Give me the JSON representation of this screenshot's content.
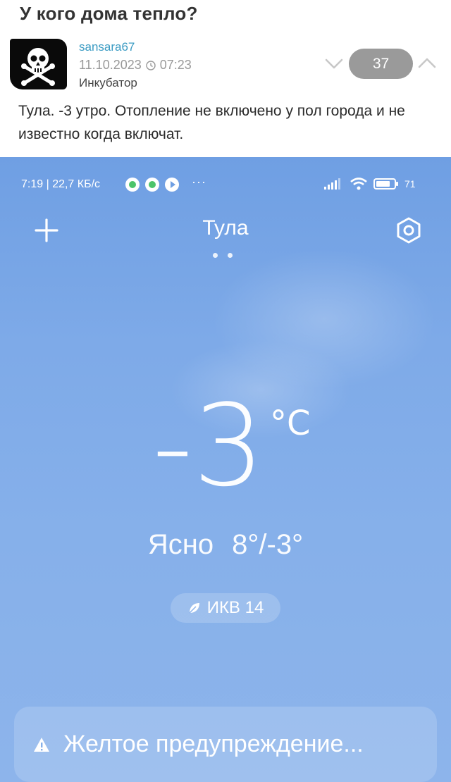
{
  "post": {
    "title": "У кого дома тепло?",
    "author": "sansara67",
    "date": "11.10.2023",
    "time": "07:23",
    "community": "Инкубатор",
    "rating": "37",
    "text": "Тула. -3 утро. Отопление не включено у пол города и не известно когда включат."
  },
  "screenshot": {
    "status_bar": {
      "time_speed": "7:19 | 22,7 КБ/с",
      "more": "···",
      "battery": "71"
    },
    "city": "Тула",
    "temperature": "-3",
    "unit": "°C",
    "condition": "Ясно",
    "high_low": "8°/-3°",
    "aqi": "ИКВ 14",
    "warning": "Желтое предупреждение..."
  },
  "colors": {
    "sky_top": "#6f9fe3",
    "sky_bottom": "#8db4eb",
    "author_link": "#3a9bc3",
    "rating_bg": "#9a9a9a"
  }
}
